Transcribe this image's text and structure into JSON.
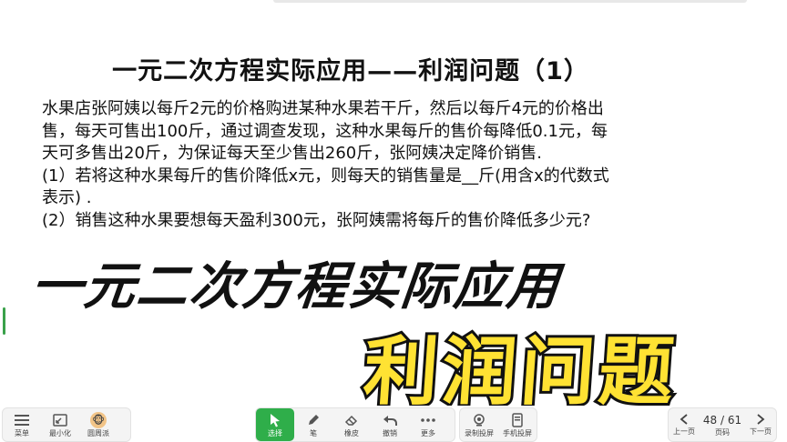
{
  "slide": {
    "title": "一元二次方程实际应用——利润问题（1）",
    "problem_lines": [
      "水果店张阿姨以每斤2元的价格购进某种水果若干斤，然后以每斤4元的价格出",
      "售，每天可售出100斤，通过调查发现，这种水果每斤的售价每降低0.1元，每",
      "天可多售出20斤，为保证每天至少售出260斤，张阿姨决定降价销售.",
      "(1）若将这种水果每斤的售价降低x元，则每天的销售量是__斤(用含x的代数式",
      "表示) .",
      "(2）销售这种水果要想每天盈利300元，张阿姨需将每斤的售价降低多少元?"
    ],
    "banner_top": "一元二次方程实际应用",
    "banner_bottom": "利润问题"
  },
  "toolbar": {
    "left": [
      {
        "icon": "menu-icon",
        "label": "菜单"
      },
      {
        "icon": "minimize-icon",
        "label": "最小化"
      },
      {
        "icon": "avatar-icon",
        "label": "圆周派"
      }
    ],
    "center": [
      {
        "icon": "cursor-icon",
        "label": "选择",
        "active": true
      },
      {
        "icon": "pen-icon",
        "label": "笔"
      },
      {
        "icon": "eraser-icon",
        "label": "橡皮"
      },
      {
        "icon": "undo-icon",
        "label": "撤销"
      },
      {
        "icon": "more-icon",
        "label": "更多"
      }
    ],
    "right": [
      {
        "icon": "record-icon",
        "label": "录制投屏"
      },
      {
        "icon": "phone-icon",
        "label": "手机投屏"
      }
    ],
    "pager": {
      "prev_label": "上一页",
      "page_text": "48 / 61",
      "page_label": "页码",
      "next_label": "下一页"
    }
  },
  "colors": {
    "accent": "#2fae4a",
    "banner_yellow": "#ffe233"
  }
}
